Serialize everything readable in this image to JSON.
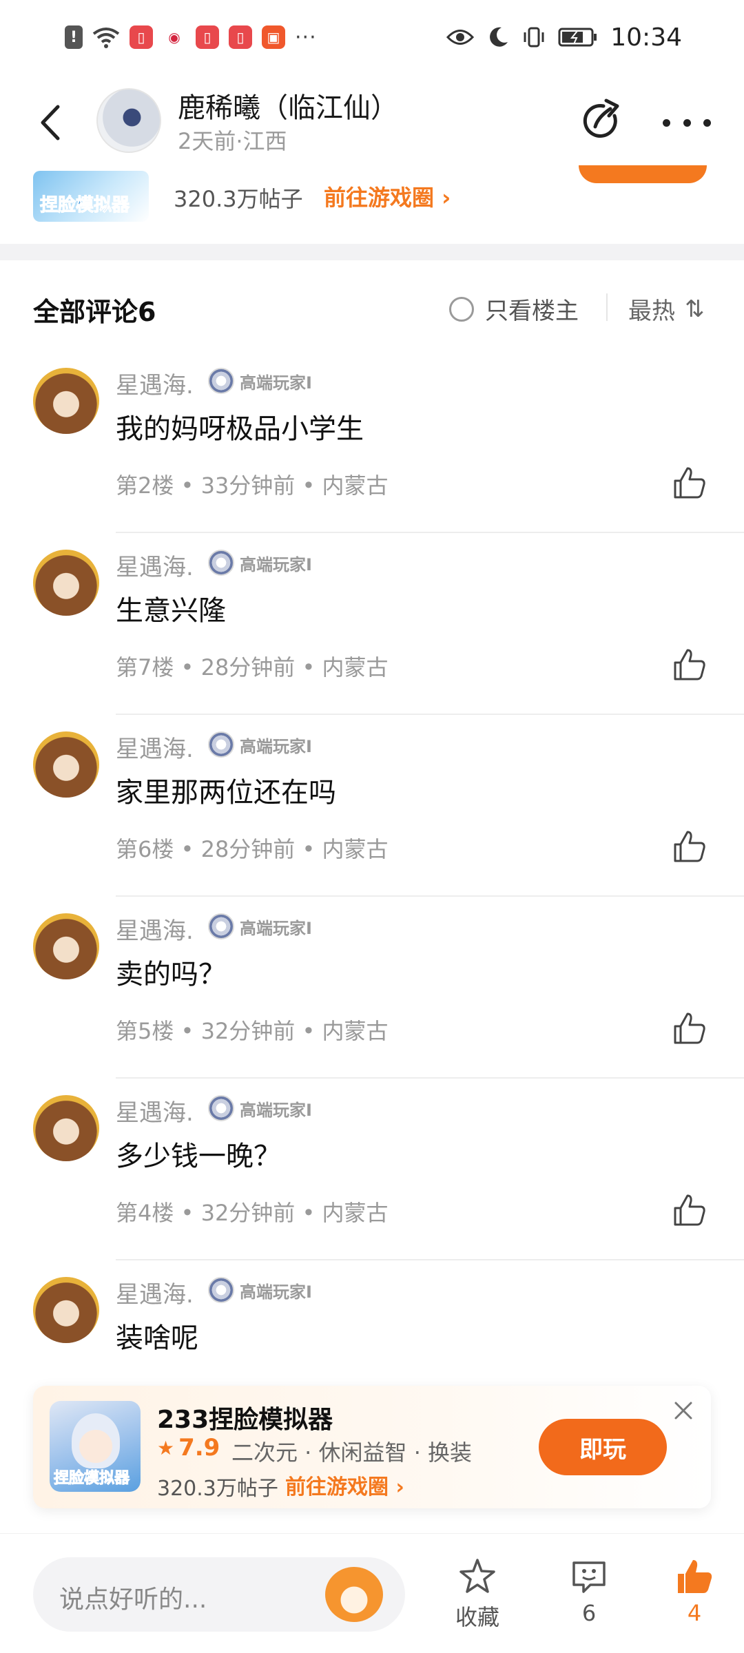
{
  "status_bar": {
    "time": "10:34",
    "more_dots": "···"
  },
  "header": {
    "author_name": "鹿稀曦（临江仙）",
    "author_meta": "2天前·江西"
  },
  "game_strip": {
    "logo_text": "捏脸模拟器",
    "posts": "320.3万帖子",
    "link": "前往游戏圈 ›"
  },
  "comments": {
    "title": "全部评论6",
    "only_op": "只看楼主",
    "sort": "最热",
    "sort_icon": "⇅",
    "items": [
      {
        "name": "星遇海.",
        "badge": "高端玩家I",
        "text": "我的妈呀极品小学生",
        "meta": "第2楼 • 33分钟前 • 内蒙古"
      },
      {
        "name": "星遇海.",
        "badge": "高端玩家I",
        "text": "生意兴隆",
        "meta": "第7楼 • 28分钟前 • 内蒙古"
      },
      {
        "name": "星遇海.",
        "badge": "高端玩家I",
        "text": "家里那两位还在吗",
        "meta": "第6楼 • 28分钟前 • 内蒙古"
      },
      {
        "name": "星遇海.",
        "badge": "高端玩家I",
        "text": "卖的吗？",
        "meta": "第5楼 • 32分钟前 • 内蒙古"
      },
      {
        "name": "星遇海.",
        "badge": "高端玩家I",
        "text": "多少钱一晚？",
        "meta": "第4楼 • 32分钟前 • 内蒙古"
      },
      {
        "name": "星遇海.",
        "badge": "高端玩家I",
        "text": "装啥呢",
        "meta": ""
      }
    ]
  },
  "game_card": {
    "title": "233捏脸模拟器",
    "rating": "7.9",
    "tags": "二次元 · 休闲益智 · 换装",
    "posts": "320.3万帖子",
    "link": "前往游戏圈 ›",
    "play": "即玩",
    "logo_text": "捏脸模拟器"
  },
  "bottom_bar": {
    "input_placeholder": "说点好听的...",
    "favorite_label": "收藏",
    "comment_count": "6",
    "like_count": "4"
  },
  "colors": {
    "accent": "#f4791f",
    "text_primary": "#111111",
    "text_secondary": "#9a9a9a"
  }
}
